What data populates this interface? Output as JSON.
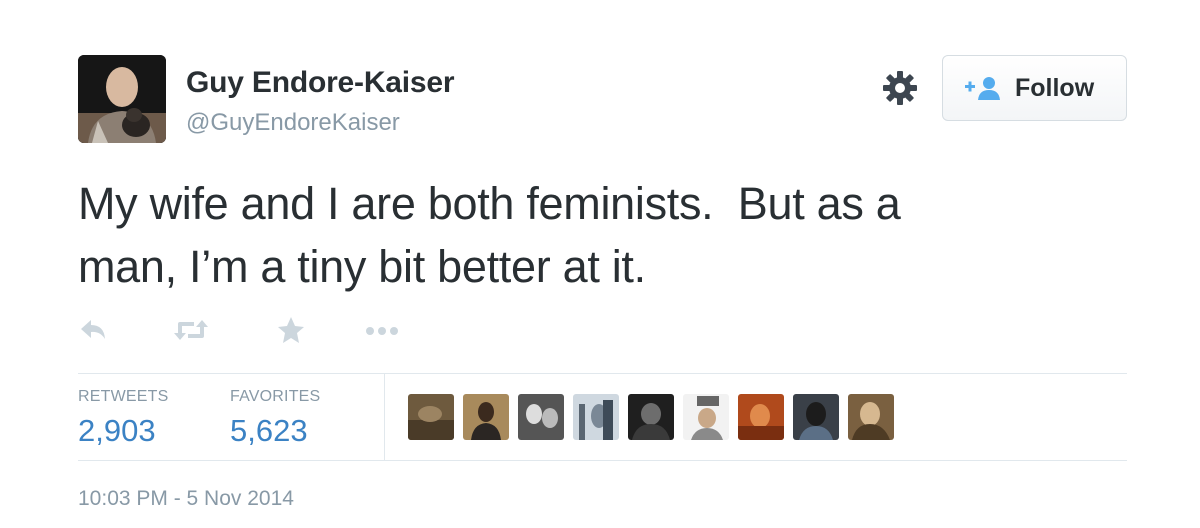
{
  "author": {
    "name": "Guy Endore-Kaiser",
    "handle": "@GuyEndoreKaiser"
  },
  "header": {
    "follow_label": "Follow",
    "gear_icon": "gear-icon",
    "follow_icon": "add-user-icon"
  },
  "tweet": {
    "text_line1": "My wife and I are both feminists.  But as a",
    "text_line2": "man, I’m a tiny bit better at it."
  },
  "actions": [
    "reply-icon",
    "retweet-icon",
    "favorite-star-icon",
    "more-dots-icon"
  ],
  "stats": {
    "retweets_label": "RETWEETS",
    "retweets_value": "2,903",
    "favorites_label": "FAVORITES",
    "favorites_value": "5,623"
  },
  "favoriters_count_shown": 9,
  "timestamp": "10:03 PM - 5 Nov 2014",
  "colors": {
    "text": "#292f33",
    "muted": "#8899a6",
    "stat_value": "#3b82c4",
    "border": "#e1e8ed"
  }
}
